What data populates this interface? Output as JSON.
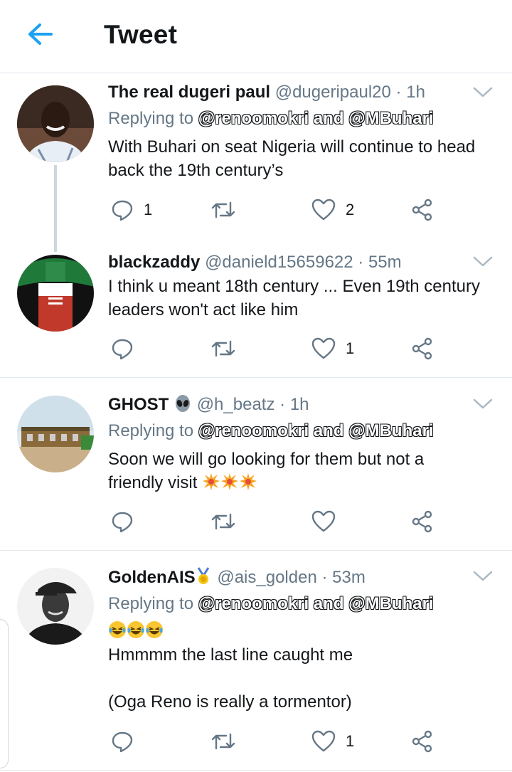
{
  "header": {
    "title": "Tweet"
  },
  "tweets": [
    {
      "name": "The real dugeri paul",
      "handle": "@dugeripaul20",
      "time": "1h",
      "replying_prefix": "Replying to",
      "replying_to": "@renoomokri and @MBuhari",
      "text": "With Buhari on seat Nigeria will continue to head back the 19th century’s",
      "reply_count": "1",
      "like_count": "2"
    },
    {
      "name": "blackzaddy",
      "handle": "@danield15659622",
      "time": "55m",
      "text": "I think u meant 18th century ... Even 19th century leaders won't act like him",
      "like_count": "1"
    },
    {
      "name": "GHOST",
      "name_emoji": "👽",
      "handle": "@h_beatz",
      "time": "1h",
      "replying_prefix": "Replying to",
      "replying_to": "@renoomokri and @MBuhari",
      "text": "Soon we will go looking for them but not a friendly visit"
    },
    {
      "name": "GoldenAIS",
      "handle": "@ais_golden",
      "time": "53m",
      "replying_prefix": "Replying to",
      "replying_to": "@renoomokri and @MBuhari",
      "text_line1": "Hmmmm the last line caught me",
      "text_line2": "(Oga Reno is really a tormentor)",
      "like_count": "1"
    }
  ],
  "colors": {
    "accent": "#1da1f2",
    "icon": "#657786",
    "border": "#e1e8ed"
  },
  "icons": [
    "back-arrow-icon",
    "chevron-down-icon",
    "reply-icon",
    "retweet-icon",
    "like-icon",
    "share-icon"
  ]
}
